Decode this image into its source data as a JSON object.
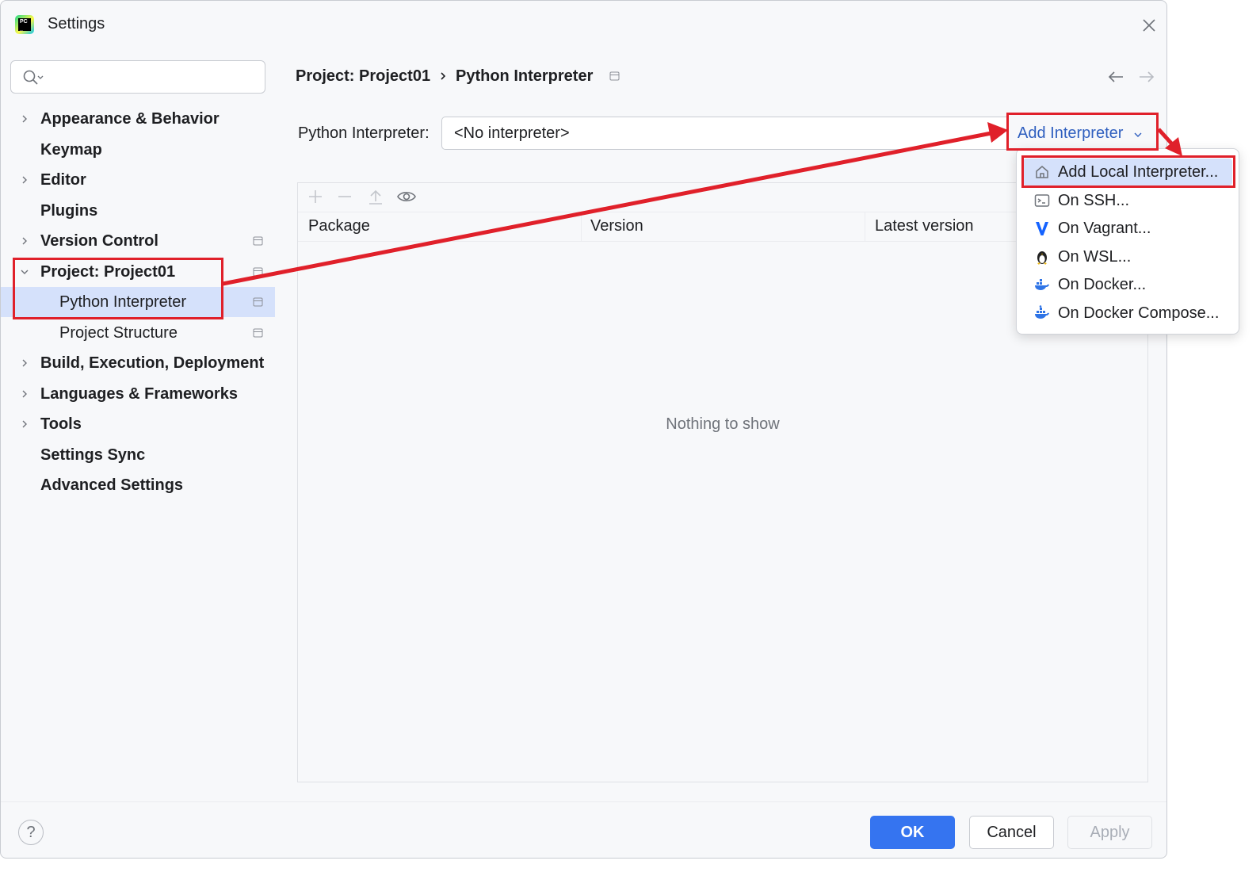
{
  "window": {
    "title": "Settings"
  },
  "search": {
    "placeholder": ""
  },
  "sidebar": {
    "items": [
      {
        "label": "Appearance & Behavior"
      },
      {
        "label": "Keymap"
      },
      {
        "label": "Editor"
      },
      {
        "label": "Plugins"
      },
      {
        "label": "Version Control"
      },
      {
        "label": "Project: Project01"
      },
      {
        "label": "Python Interpreter"
      },
      {
        "label": "Project Structure"
      },
      {
        "label": "Build, Execution, Deployment"
      },
      {
        "label": "Languages & Frameworks"
      },
      {
        "label": "Tools"
      },
      {
        "label": "Settings Sync"
      },
      {
        "label": "Advanced Settings"
      }
    ]
  },
  "breadcrumb": {
    "project": "Project: Project01",
    "page": "Python Interpreter"
  },
  "interpreter": {
    "label": "Python Interpreter:",
    "value": "<No interpreter>",
    "add_label": "Add Interpreter"
  },
  "packages": {
    "columns": [
      "Package",
      "Version",
      "Latest version"
    ],
    "empty_text": "Nothing to show"
  },
  "add_menu": {
    "items": [
      {
        "label": "Add Local Interpreter...",
        "icon": "home-icon"
      },
      {
        "label": "On SSH...",
        "icon": "terminal-icon"
      },
      {
        "label": "On Vagrant...",
        "icon": "vagrant-icon"
      },
      {
        "label": "On WSL...",
        "icon": "linux-penguin-icon"
      },
      {
        "label": "On Docker...",
        "icon": "docker-icon"
      },
      {
        "label": "On Docker Compose...",
        "icon": "docker-compose-icon"
      }
    ]
  },
  "footer": {
    "help": "?",
    "ok": "OK",
    "cancel": "Cancel",
    "apply": "Apply"
  },
  "colors": {
    "accent": "#3574f0",
    "link": "#2f5fbf",
    "selection": "#d5e1fb",
    "annotation": "#e0202a"
  }
}
